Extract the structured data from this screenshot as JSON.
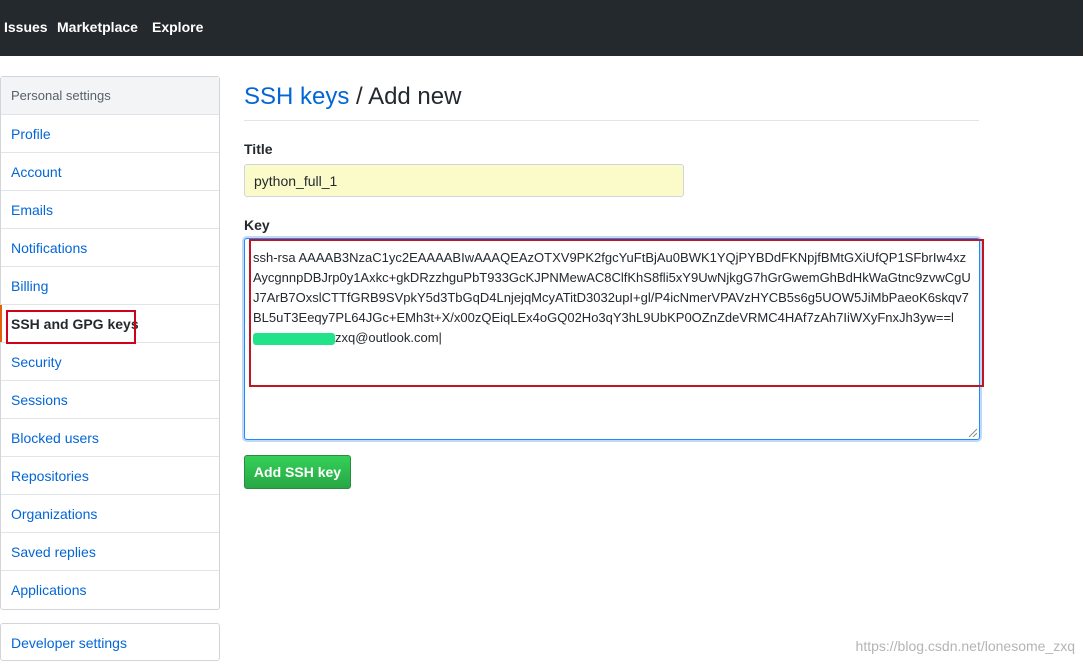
{
  "topnav": {
    "items": [
      "Issues",
      "Marketplace",
      "Explore"
    ]
  },
  "sidebar": {
    "header": "Personal settings",
    "items": [
      {
        "label": "Profile"
      },
      {
        "label": "Account"
      },
      {
        "label": "Emails"
      },
      {
        "label": "Notifications"
      },
      {
        "label": "Billing"
      },
      {
        "label": "SSH and GPG keys",
        "selected": true
      },
      {
        "label": "Security"
      },
      {
        "label": "Sessions"
      },
      {
        "label": "Blocked users"
      },
      {
        "label": "Repositories"
      },
      {
        "label": "Organizations"
      },
      {
        "label": "Saved replies"
      },
      {
        "label": "Applications"
      }
    ],
    "developer_settings": "Developer settings"
  },
  "main": {
    "title_link": "SSH keys",
    "title_sep": " / ",
    "title_rest": "Add new",
    "title_label": "Title",
    "title_value": "python_full_1",
    "key_label": "Key",
    "key_value_start": "ssh-rsa AAAAB3NzaC1yc2EAAAABIwAAAQEAzOTXV9PK2fgcYuFtBjAu0BWK1YQjPYBDdFKNpjfBMtGXiUfQP1SFbrIw4xzAycgnnpDBJrp0y1Axkc+gkDRzzhguPbT933GcKJPNMewAC8ClfKhS8fli5xY9UwNjkgG7hGrGwemGhBdHkWaGtnc9zvwCgUJ7ArB7OxslCTTfGRB9SVpkY5d3TbGqD4LnjejqMcyATitD3032upI+gl/P4icNmerVPAVzHYCB5s6g5UOW5JiMbPaeoK6skqv7BL5uT3Eeqy7PL64JGc+EMh3t+X/x00zQEiqLEx4oGQ02Ho3qY3hL9UbKP0OZnZdeVRMC4HAf7zAh7IiWXyFnxJh3yw==l",
    "key_value_end": "zxq@outlook.com",
    "add_button": "Add SSH key"
  },
  "watermark": "https://blog.csdn.net/lonesome_zxq",
  "colors": {
    "nav_bg": "#24292e",
    "link": "#0366d6",
    "highlight_red": "#d0021b",
    "button_green": "#28a745",
    "title_input_bg": "#fbfbca"
  }
}
